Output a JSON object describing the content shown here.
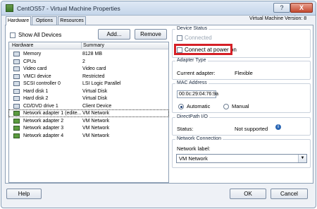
{
  "window": {
    "title": "CentOS57 - Virtual Machine Properties",
    "help_button": "?",
    "close_button": "X"
  },
  "tabs": [
    {
      "label": "Hardware",
      "active": true
    },
    {
      "label": "Options",
      "active": false
    },
    {
      "label": "Resources",
      "active": false
    }
  ],
  "vm_version": "Virtual Machine Version: 8",
  "hardware_panel": {
    "show_all_label": "Show All Devices",
    "add_button": "Add...",
    "remove_button": "Remove",
    "columns": [
      "Hardware",
      "Summary"
    ],
    "rows": [
      {
        "name": "Memory",
        "summary": "8128 MB",
        "icon": "memory-icon"
      },
      {
        "name": "CPUs",
        "summary": "2",
        "icon": "cpu-icon"
      },
      {
        "name": "Video card",
        "summary": "Video card",
        "icon": "video-card-icon"
      },
      {
        "name": "VMCI device",
        "summary": "Restricted",
        "icon": "vmci-icon"
      },
      {
        "name": "SCSI controller 0",
        "summary": "LSI Logic Parallel",
        "icon": "scsi-icon"
      },
      {
        "name": "Hard disk 1",
        "summary": "Virtual Disk",
        "icon": "hard-disk-icon"
      },
      {
        "name": "Hard disk 2",
        "summary": "Virtual Disk",
        "icon": "hard-disk-icon"
      },
      {
        "name": "CD/DVD drive 1",
        "summary": "Client Device",
        "icon": "cd-drive-icon"
      },
      {
        "name": "Network adapter 1 (edite...",
        "summary": "VM Network",
        "icon": "network-adapter-icon",
        "selected": true
      },
      {
        "name": "Network adapter 2",
        "summary": "VM Network",
        "icon": "network-adapter-icon"
      },
      {
        "name": "Network adapter 3",
        "summary": "VM Network",
        "icon": "network-adapter-icon"
      },
      {
        "name": "Network adapter 4",
        "summary": "VM Network",
        "icon": "network-adapter-icon"
      }
    ]
  },
  "device_status": {
    "title": "Device Status",
    "connected_label": "Connected",
    "connect_at_power_on_label": "Connect at power on"
  },
  "adapter_type": {
    "title": "Adapter Type",
    "current_label": "Current adapter:",
    "current_value": "Flexible"
  },
  "mac_address": {
    "title": "MAC Address",
    "value": "00:0c:29:04:76:9a",
    "automatic_label": "Automatic",
    "manual_label": "Manual",
    "selected": "Automatic"
  },
  "directpath": {
    "title": "DirectPath I/O",
    "status_label": "Status:",
    "status_value": "Not supported"
  },
  "network_connection": {
    "title": "Network Connection",
    "network_label": "Network label:",
    "selected_network": "VM Network"
  },
  "footer": {
    "help": "Help",
    "ok": "OK",
    "cancel": "Cancel"
  },
  "colors": {
    "highlight_box": "#d52026",
    "accent": "#2a66b4"
  }
}
